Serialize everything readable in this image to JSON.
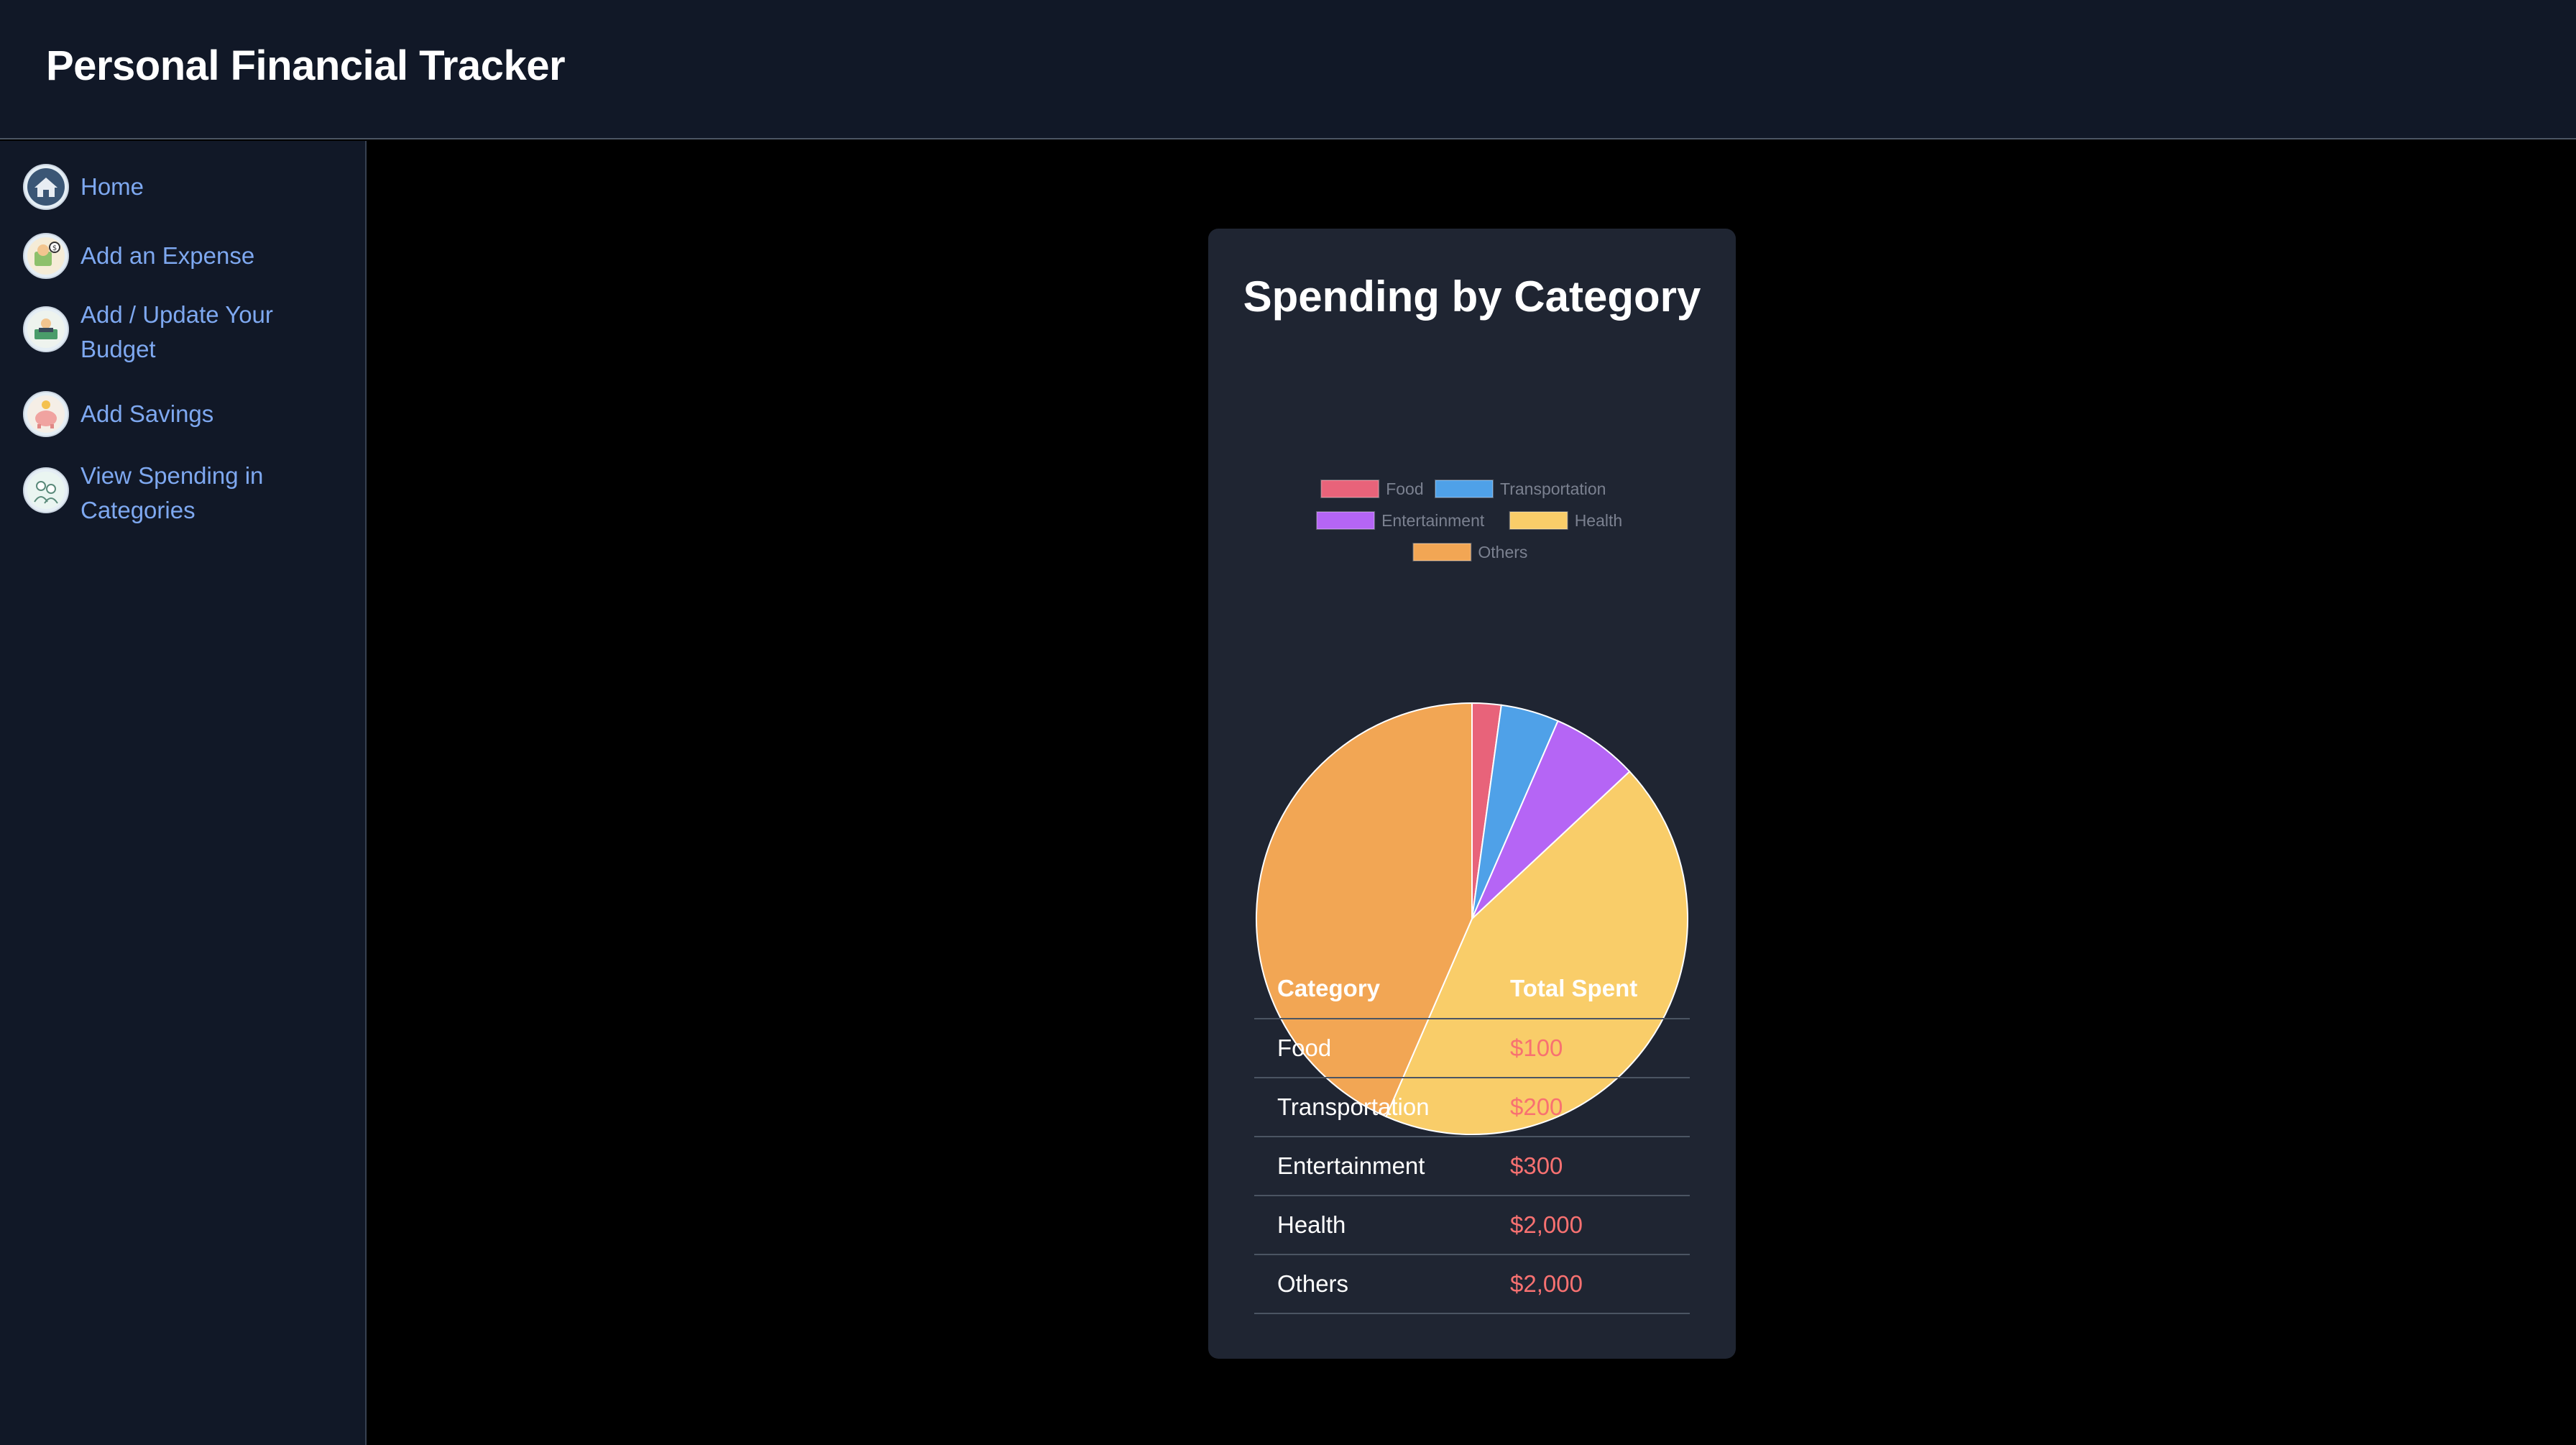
{
  "header": {
    "title": "Personal Financial Tracker"
  },
  "sidebar": {
    "items": [
      {
        "label": "Home",
        "icon": "home-icon"
      },
      {
        "label": "Add an Expense",
        "icon": "expense-icon"
      },
      {
        "label": "Add / Update Your Budget",
        "icon": "budget-icon"
      },
      {
        "label": "Add Savings",
        "icon": "piggy-bank-icon"
      },
      {
        "label": "View Spending in Categories",
        "icon": "categories-icon"
      }
    ]
  },
  "card": {
    "title": "Spending by Category",
    "table": {
      "headers": [
        "Category",
        "Total Spent"
      ],
      "rows": [
        {
          "category": "Food",
          "amount": "$100"
        },
        {
          "category": "Transportation",
          "amount": "$200"
        },
        {
          "category": "Entertainment",
          "amount": "$300"
        },
        {
          "category": "Health",
          "amount": "$2,000"
        },
        {
          "category": "Others",
          "amount": "$2,000"
        }
      ]
    }
  },
  "chart_data": {
    "type": "pie",
    "title": "Spending by Category",
    "categories": [
      "Food",
      "Transportation",
      "Entertainment",
      "Health",
      "Others"
    ],
    "values": [
      100,
      200,
      300,
      2000,
      2000
    ],
    "colors": [
      "#e8637a",
      "#4fa1e8",
      "#b565f5",
      "#f9cd69",
      "#f2a654"
    ],
    "legend": "top"
  }
}
